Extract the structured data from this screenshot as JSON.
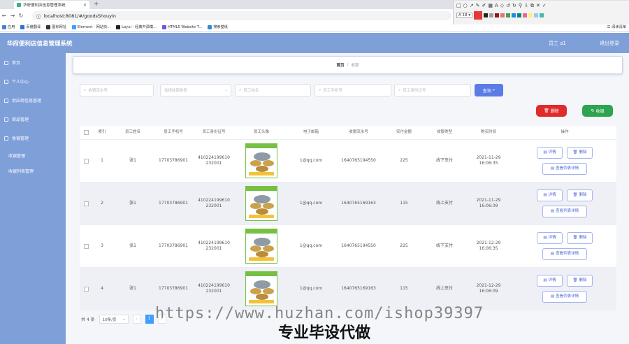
{
  "browser": {
    "tab_title": "华府便利店信息管理系统",
    "url": "localhost:8081/#/goodsShouyin",
    "bookmarks": [
      "应用",
      "百度翻译",
      "图标网址",
      "Element - 网站快...",
      "Layui - 经典开源模...",
      "HTML5 Website T...",
      "搜索壁纸"
    ],
    "reading_list": "阅读清单",
    "annotation_font_size": "18"
  },
  "colors": {
    "header": "#7f9fd8",
    "primary": "#5b7ce6",
    "danger": "#e02b2b",
    "success": "#2ea44f",
    "annotation_swatches": [
      "#e53935",
      "#222222",
      "#9e9e9e",
      "#8b1a1a",
      "#e57373",
      "#43a047",
      "#1e88e5",
      "#00897b",
      "#ffffff",
      "#bdbdbd",
      "#ffb74d",
      "#f06292",
      "#fff176",
      "#aed581",
      "#90caf9",
      "#4db6ac"
    ]
  },
  "header": {
    "title": "华府便利店信息管理系统",
    "user": "员工 a1",
    "logout": "退出登录"
  },
  "sidebar": {
    "items": [
      "首页",
      "个人中心",
      "供应商信息管理",
      "商品管理",
      "收银管理"
    ],
    "sub_items": [
      "收银管理",
      "收银列表管理"
    ]
  },
  "breadcrumb": {
    "home": "首页",
    "separator": "/",
    "current": "收银"
  },
  "filters": {
    "order_no": "收银流水号",
    "pay_type": "选择收银类型",
    "employee_name": "员工姓名",
    "employee_phone": "员工手机号",
    "employee_id_card": "员工身份证号",
    "search_label": "查询"
  },
  "actions": {
    "delete_label": "删除",
    "add_label": "收银"
  },
  "table": {
    "headers": [
      "索引",
      "员工姓名",
      "员工手机号",
      "员工身份证号",
      "员工头像",
      "电子邮箱",
      "收银流水号",
      "实付金额",
      "收银类型",
      "购买时间",
      "操作"
    ],
    "rows": [
      {
        "index": "1",
        "name": "张1",
        "phone": "17703786901",
        "id_card": "410224199610232001",
        "email": "1@qq.com",
        "order_no": "1640765194550",
        "amount": "225",
        "type": "线下支付",
        "time": "2021-11-29 16:06:35"
      },
      {
        "index": "2",
        "name": "张1",
        "phone": "17703786901",
        "id_card": "410224199610232001",
        "email": "1@qq.com",
        "order_no": "1640765169163",
        "amount": "115",
        "type": "线上支付",
        "time": "2021-11-29 16:06:09"
      },
      {
        "index": "3",
        "name": "张1",
        "phone": "17703786901",
        "id_card": "410224199610232001",
        "email": "1@qq.com",
        "order_no": "1640765194550",
        "amount": "225",
        "type": "线下支付",
        "time": "2021-12-29 16:06:35"
      },
      {
        "index": "4",
        "name": "张1",
        "phone": "17703786901",
        "id_card": "410224199610232001",
        "email": "1@qq.com",
        "order_no": "1640765169163",
        "amount": "115",
        "type": "线上支付",
        "time": "2021-12-29 16:06:09"
      }
    ],
    "op_detail": "详情",
    "op_delete": "删除",
    "op_list_detail": "查看列表详情"
  },
  "pagination": {
    "total": "共 4 条",
    "page_size": "10条/页",
    "current_page": "1"
  },
  "watermark": {
    "url": "https://www.huzhan.com/ishop39397",
    "text": "专业毕设代做"
  }
}
